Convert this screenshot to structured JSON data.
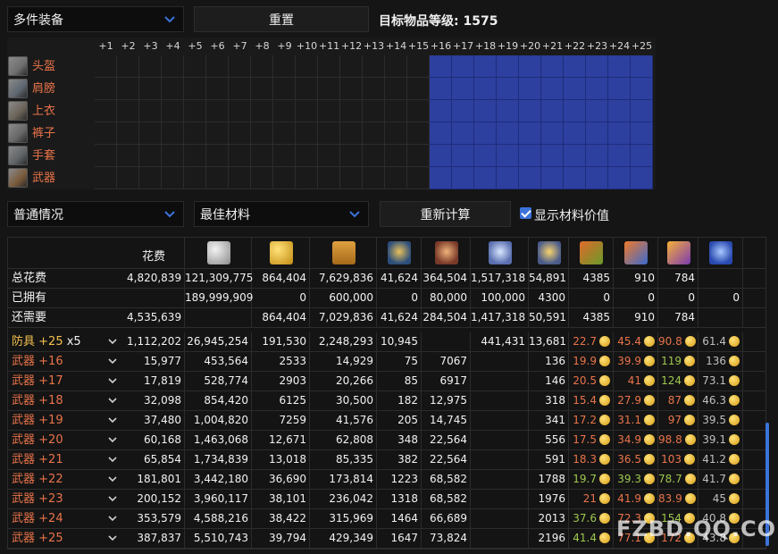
{
  "top": {
    "gear_mode": "多件装备",
    "reset_label": "重置",
    "target_label": "目标物品等级: 1575"
  },
  "grid": {
    "levels": [
      "+1",
      "+2",
      "+3",
      "+4",
      "+5",
      "+6",
      "+7",
      "+8",
      "+9",
      "+10",
      "+11",
      "+12",
      "+13",
      "+14",
      "+15",
      "+16",
      "+17",
      "+18",
      "+19",
      "+20",
      "+21",
      "+22",
      "+23",
      "+24",
      "+25"
    ],
    "selected_from_index": 15,
    "slots": [
      {
        "name": "头盔",
        "icon": "helmet-icon"
      },
      {
        "name": "肩膀",
        "icon": "shoulder-icon"
      },
      {
        "name": "上衣",
        "icon": "chest-icon"
      },
      {
        "name": "裤子",
        "icon": "pants-icon"
      },
      {
        "name": "手套",
        "icon": "gloves-icon"
      },
      {
        "name": "武器",
        "icon": "weapon-icon"
      }
    ]
  },
  "controls": {
    "scenario": "普通情况",
    "material_mode": "最佳材料",
    "recalc_label": "重新计算",
    "show_value_label": "显示材料价值",
    "show_value_checked": true
  },
  "table": {
    "cost_header": "花费",
    "material_icons": [
      "silver-coin-icon",
      "gold-coin-icon",
      "honor-shard-icon",
      "guardian-stone-icon",
      "destruction-stone-icon",
      "crystal-icon",
      "star-breath-icon",
      "green-book-icon",
      "blue-book-icon",
      "purple-book-icon",
      "sapphire-icon"
    ],
    "summary": [
      {
        "label": "总花费",
        "values": [
          "4,820,839",
          "121,309,775",
          "864,404",
          "7,629,836",
          "41,624",
          "364,504",
          "1,517,318",
          "54,891",
          "4385",
          "910",
          "784",
          ""
        ]
      },
      {
        "label": "已拥有",
        "values": [
          "",
          "189,999,909",
          "0",
          "600,000",
          "0",
          "80,000",
          "100,000",
          "4300",
          "0",
          "0",
          "0",
          "0"
        ]
      },
      {
        "label": "还需要",
        "values": [
          "4,535,639",
          "",
          "864,404",
          "7,029,836",
          "41,624",
          "284,504",
          "1,417,318",
          "50,591",
          "4385",
          "910",
          "784",
          ""
        ]
      }
    ],
    "rows": [
      {
        "item": "防具",
        "level": "+25",
        "mult": "x5",
        "values": [
          "1,112,202",
          "26,945,254",
          "191,530",
          "2,248,293",
          "10,945",
          "",
          "441,431",
          "13,681"
        ],
        "mats": [
          {
            "v": "22.7",
            "g": false
          },
          {
            "v": "45.4",
            "g": false
          },
          {
            "v": "90.8",
            "g": false
          },
          {
            "v": "61.4",
            "g": false
          }
        ]
      },
      {
        "item": "武器",
        "level": "+16",
        "mult": "",
        "values": [
          "15,977",
          "453,564",
          "2533",
          "14,929",
          "75",
          "7067",
          "",
          "136"
        ],
        "mats": [
          {
            "v": "19.9",
            "g": false
          },
          {
            "v": "39.9",
            "g": false
          },
          {
            "v": "119",
            "g": true
          },
          {
            "v": "136",
            "g": false
          }
        ]
      },
      {
        "item": "武器",
        "level": "+17",
        "mult": "",
        "values": [
          "17,819",
          "528,774",
          "2903",
          "20,266",
          "85",
          "6917",
          "",
          "146"
        ],
        "mats": [
          {
            "v": "20.5",
            "g": false
          },
          {
            "v": "41",
            "g": false
          },
          {
            "v": "124",
            "g": true
          },
          {
            "v": "73.1",
            "g": false
          }
        ]
      },
      {
        "item": "武器",
        "level": "+18",
        "mult": "",
        "values": [
          "32,098",
          "854,420",
          "6125",
          "30,500",
          "182",
          "12,975",
          "",
          "318"
        ],
        "mats": [
          {
            "v": "15.4",
            "g": false
          },
          {
            "v": "27.9",
            "g": false
          },
          {
            "v": "87",
            "g": false
          },
          {
            "v": "46.3",
            "g": false
          }
        ]
      },
      {
        "item": "武器",
        "level": "+19",
        "mult": "",
        "values": [
          "37,480",
          "1,004,820",
          "7259",
          "41,576",
          "205",
          "14,745",
          "",
          "341"
        ],
        "mats": [
          {
            "v": "17.2",
            "g": false
          },
          {
            "v": "31.1",
            "g": false
          },
          {
            "v": "97",
            "g": false
          },
          {
            "v": "39.5",
            "g": false
          }
        ]
      },
      {
        "item": "武器",
        "level": "+20",
        "mult": "",
        "values": [
          "60,168",
          "1,463,068",
          "12,671",
          "62,808",
          "348",
          "22,564",
          "",
          "556"
        ],
        "mats": [
          {
            "v": "17.5",
            "g": false
          },
          {
            "v": "34.9",
            "g": false
          },
          {
            "v": "98.8",
            "g": false
          },
          {
            "v": "39.1",
            "g": false
          }
        ]
      },
      {
        "item": "武器",
        "level": "+21",
        "mult": "",
        "values": [
          "65,854",
          "1,734,839",
          "13,018",
          "85,335",
          "382",
          "22,564",
          "",
          "591"
        ],
        "mats": [
          {
            "v": "18.3",
            "g": false
          },
          {
            "v": "36.5",
            "g": false
          },
          {
            "v": "103",
            "g": false
          },
          {
            "v": "41.2",
            "g": false
          }
        ]
      },
      {
        "item": "武器",
        "level": "+22",
        "mult": "",
        "values": [
          "181,801",
          "3,442,180",
          "36,690",
          "173,814",
          "1223",
          "68,582",
          "",
          "1788"
        ],
        "mats": [
          {
            "v": "19.7",
            "g": true
          },
          {
            "v": "39.3",
            "g": true
          },
          {
            "v": "78.7",
            "g": true
          },
          {
            "v": "41.7",
            "g": false
          }
        ]
      },
      {
        "item": "武器",
        "level": "+23",
        "mult": "",
        "values": [
          "200,152",
          "3,960,117",
          "38,101",
          "236,042",
          "1318",
          "68,582",
          "",
          "1976"
        ],
        "mats": [
          {
            "v": "21",
            "g": false
          },
          {
            "v": "41.9",
            "g": false
          },
          {
            "v": "83.9",
            "g": false
          },
          {
            "v": "45",
            "g": false
          }
        ]
      },
      {
        "item": "武器",
        "level": "+24",
        "mult": "",
        "values": [
          "353,579",
          "4,588,216",
          "38,422",
          "315,969",
          "1464",
          "66,689",
          "",
          "2013"
        ],
        "mats": [
          {
            "v": "37.6",
            "g": true
          },
          {
            "v": "72.3",
            "g": false
          },
          {
            "v": "154",
            "g": true
          },
          {
            "v": "40.8",
            "g": false
          }
        ]
      },
      {
        "item": "武器",
        "level": "+25",
        "mult": "",
        "values": [
          "387,837",
          "5,510,743",
          "39,794",
          "429,349",
          "1647",
          "73,824",
          "",
          "2196"
        ],
        "mats": [
          {
            "v": "41.4",
            "g": true
          },
          {
            "v": "77.1",
            "g": false
          },
          {
            "v": "172",
            "g": false
          },
          {
            "v": "43.8",
            "g": false
          }
        ]
      }
    ]
  },
  "watermark": "FZBD.QQ.COM",
  "colors": {
    "accent_blue": "#2d3f9f",
    "level_orange": "#e9744a",
    "good_green": "#9ec84e",
    "checkbox_blue": "#3b73d9"
  }
}
